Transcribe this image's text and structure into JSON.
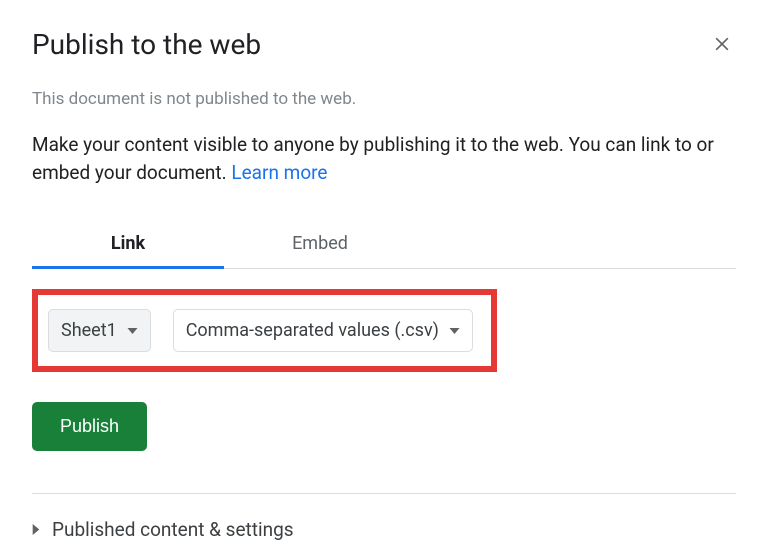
{
  "dialog": {
    "title": "Publish to the web"
  },
  "status": "This document is not published to the web.",
  "description": "Make your content visible to anyone by publishing it to the web. You can link to or embed your document. ",
  "learn_more": "Learn more",
  "tabs": {
    "link": "Link",
    "embed": "Embed"
  },
  "selectors": {
    "sheet": "Sheet1",
    "format": "Comma-separated values (.csv)"
  },
  "publish_label": "Publish",
  "expander_label": "Published content & settings"
}
